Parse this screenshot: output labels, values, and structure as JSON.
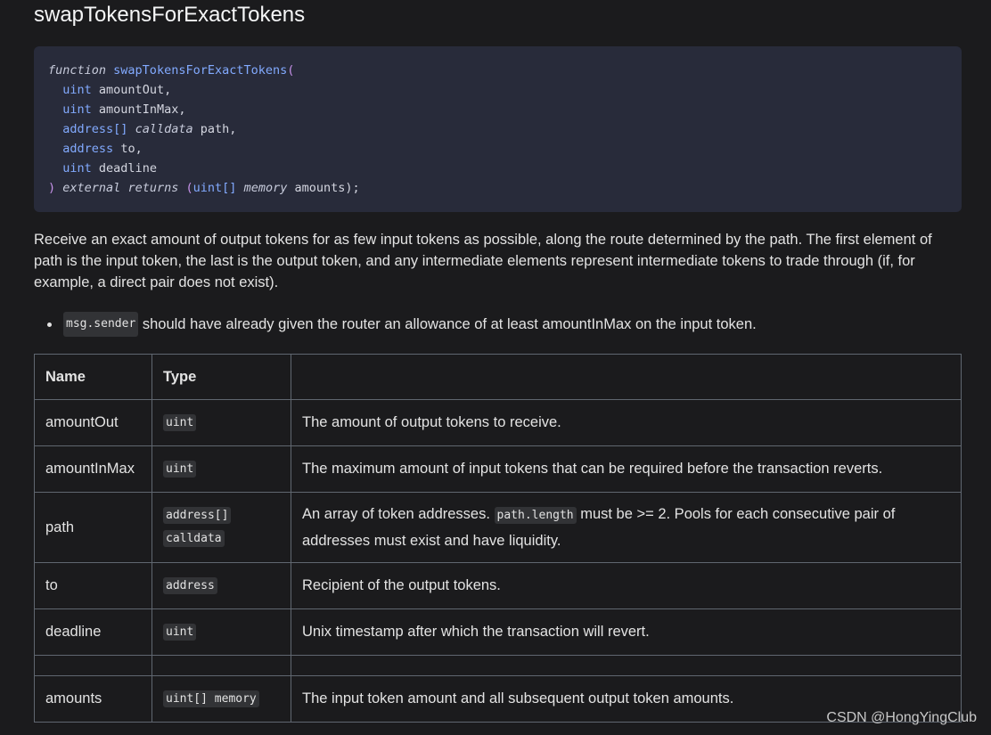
{
  "title": "swapTokensForExactTokens",
  "code": {
    "kw_function": "function",
    "fn_name": "swapTokensForExactTokens",
    "open_paren": "(",
    "params": [
      {
        "type": "uint",
        "name": "amountOut,"
      },
      {
        "type": "uint",
        "name": "amountInMax,"
      },
      {
        "type": "address[]",
        "modifier": "calldata",
        "name": "path,"
      },
      {
        "type": "address",
        "name": "to,"
      },
      {
        "type": "uint",
        "name": "deadline"
      }
    ],
    "close_paren": ")",
    "kw_external": "external",
    "kw_returns": "returns",
    "ret_open": "(",
    "ret_type": "uint[]",
    "ret_memory": "memory",
    "ret_name": "amounts);"
  },
  "description": "Receive an exact amount of output tokens for as few input tokens as possible, along the route determined by the path. The first element of path is the input token, the last is the output token, and any intermediate elements represent intermediate tokens to trade through (if, for example, a direct pair does not exist).",
  "bullet": {
    "code": "msg.sender",
    "text": " should have already given the router an allowance of at least amountInMax on the input token."
  },
  "table": {
    "headers": [
      "Name",
      "Type",
      ""
    ],
    "rows": [
      {
        "name": "amountOut",
        "type": "uint",
        "desc": "The amount of output tokens to receive."
      },
      {
        "name": "amountInMax",
        "type": "uint",
        "desc": "The maximum amount of input tokens that can be required before the transaction reverts."
      },
      {
        "name": "path",
        "type_line1": "address[]",
        "type_line2": "calldata",
        "desc_pre": "An array of token addresses. ",
        "desc_code": "path.length",
        "desc_post": " must be >= 2. Pools for each consecutive pair of addresses must exist and have liquidity."
      },
      {
        "name": "to",
        "type": "address",
        "desc": "Recipient of the output tokens."
      },
      {
        "name": "deadline",
        "type": "uint",
        "desc": "Unix timestamp after which the transaction will revert."
      },
      {
        "name": "amounts",
        "type": "uint[] memory",
        "desc": "The input token amount and all subsequent output token amounts."
      }
    ]
  },
  "watermark": "CSDN @HongYingClub"
}
